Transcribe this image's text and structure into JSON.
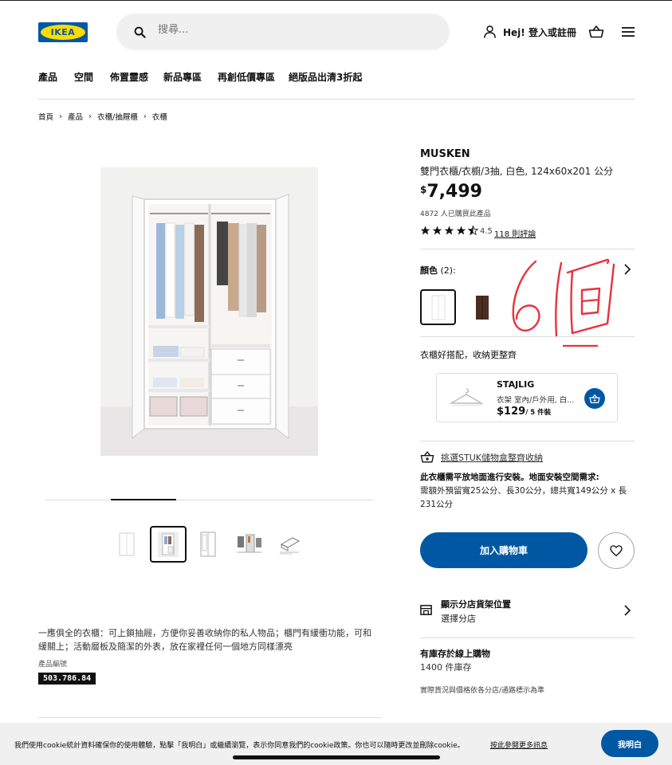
{
  "header": {
    "logo_text": "IKEA",
    "search_placeholder": "搜尋...",
    "login_label": "Hej! 登入或註冊"
  },
  "nav": {
    "items": [
      "產品",
      "空間",
      "佈置靈感",
      "新品專區",
      "再創低價專區",
      "絕版品出清3折起"
    ]
  },
  "breadcrumb": [
    "首頁",
    "產品",
    "衣櫃/抽屜櫃",
    "衣櫃"
  ],
  "gallery": {
    "thumbnail_count": 5,
    "selected_index": 1
  },
  "product": {
    "name": "MUSKEN",
    "description": "雙門衣櫃/衣櫥/3抽, 白色, 124x60x201 公分",
    "currency": "$",
    "price": "7,499",
    "bought_text": "4872 人已購買此產品",
    "rating": "4.5",
    "reviews_link": "118 則評論",
    "color_label": "顏色",
    "color_count": "(2):",
    "annotation": "6個",
    "long_description": "一應俱全的衣櫃：可上鎖抽屜，方便你妥善收納你的私人物品；櫃門有緩衝功能，可和緩關上；活動層板及簡潔的外表，放在家裡任何一個地方同樣漂亮",
    "article_label": "產品編號",
    "article_number": "503.786.84"
  },
  "accessory": {
    "section_title": "衣櫃好搭配，收納更整齊",
    "name": "STAJLIG",
    "sub": "衣架 室內/戶外用, 白...",
    "price": "$129",
    "unit": "/ 5 件裝"
  },
  "stuk": {
    "link": "挑選STUK儲物盒整齊收納"
  },
  "install": {
    "title": "此衣櫃需平放地面進行安裝。地面安裝空間需求:",
    "text": "需額外預留寬25公分、長30公分，總共寬149公分 x 長231公分"
  },
  "actions": {
    "add_to_cart": "加入購物車"
  },
  "store": {
    "title": "顯示分店貨架位置",
    "sub": "選擇分店"
  },
  "stock": {
    "title": "有庫存於線上購物",
    "sub": "1400 件庫存",
    "note": "實際貨況與價格依各分店/通路標示為準"
  },
  "cookie": {
    "text": "我們使用cookie統計資料確保你的使用體驗，點擊「我明白」或繼續瀏覽，表示你同意我們的cookie政策。你也可以隨時更改並刪除cookie。",
    "link": "按此參閱更多訊息",
    "button": "我明白"
  },
  "colors": {
    "brand_blue": "#0058a3",
    "brand_yellow": "#ffdb00",
    "annotation_red": "#e8323c"
  }
}
